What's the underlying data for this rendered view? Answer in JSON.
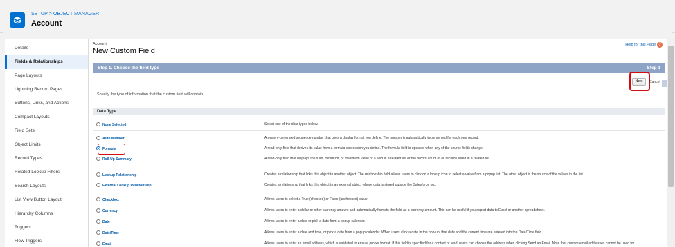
{
  "header": {
    "breadcrumb": "SETUP > OBJECT MANAGER",
    "object_title": "Account",
    "icon": "layers-icon"
  },
  "sidebar": {
    "items": [
      {
        "label": "Details"
      },
      {
        "label": "Fields & Relationships",
        "active": true
      },
      {
        "label": "Page Layouts"
      },
      {
        "label": "Lightning Record Pages"
      },
      {
        "label": "Buttons, Links, and Actions"
      },
      {
        "label": "Compact Layouts"
      },
      {
        "label": "Field Sets"
      },
      {
        "label": "Object Limits"
      },
      {
        "label": "Record Types"
      },
      {
        "label": "Related Lookup Filters"
      },
      {
        "label": "Search Layouts"
      },
      {
        "label": "List View Button Layout"
      },
      {
        "label": "Hierarchy Columns"
      },
      {
        "label": "Triggers"
      },
      {
        "label": "Flow Triggers"
      }
    ]
  },
  "main": {
    "pretitle": "Account",
    "title": "New Custom Field",
    "help_link": "Help for this Page",
    "step_title": "Step 1. Choose the field type",
    "step_right": "Step 1",
    "next_label": "Next",
    "cancel_label": "Cancel",
    "intro": "Specify the type of information that the custom field will contain.",
    "data_type_header": "Data Type",
    "options": [
      {
        "label": "None Selected",
        "desc": "Select one of the data types below.",
        "checked": false
      },
      {
        "label": "Auto Number",
        "desc": "A system-generated sequence number that uses a display format you define. The number is automatically incremented for each new record.",
        "checked": false
      },
      {
        "label": "Formula",
        "desc": "A read-only field that derives its value from a formula expression you define. The formula field is updated when any of the source fields change.",
        "checked": true
      },
      {
        "label": "Roll-Up Summary",
        "desc": "A read-only field that displays the sum, minimum, or maximum value of a field in a related list or the record count of all records listed in a related list.",
        "checked": false
      },
      {
        "label": "Lookup Relationship",
        "desc": "Creates a relationship that links this object to another object. The relationship field allows users to click on a lookup icon to select a value from a popup list. The other object is the source of the values in the list.",
        "checked": false
      },
      {
        "label": "External Lookup Relationship",
        "desc": "Creates a relationship that links this object to an external object whose data is stored outside the Salesforce org.",
        "checked": false
      },
      {
        "label": "Checkbox",
        "desc": "Allows users to select a True (checked) or False (unchecked) value.",
        "checked": false
      },
      {
        "label": "Currency",
        "desc": "Allows users to enter a dollar or other currency amount and automatically formats the field as a currency amount. This can be useful if you export data to Excel or another spreadsheet.",
        "checked": false
      },
      {
        "label": "Date",
        "desc": "Allows users to enter a date or pick a date from a popup calendar.",
        "checked": false
      },
      {
        "label": "Date/Time",
        "desc": "Allows users to enter a date and time, or pick a date from a popup calendar. When users click a date in the pop-up, that date and the current time are entered into the Date/Time field.",
        "checked": false
      },
      {
        "label": "Email",
        "desc": "Allows users to enter an email address, which is validated to ensure proper format. If this field is specified for a contact or lead, users can choose the address when clicking Send an Email. Note that custom email addresses cannot be used for",
        "checked": false
      }
    ]
  },
  "colors": {
    "accent": "#0070d2",
    "step_bar": "#8ea4c6",
    "highlight_box": "#d10d10"
  }
}
